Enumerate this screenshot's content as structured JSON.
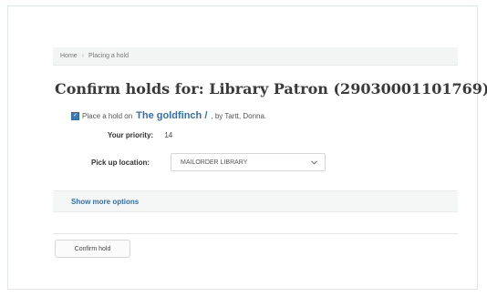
{
  "breadcrumb": {
    "items": [
      "Home",
      "Placing a hold"
    ],
    "separator": "›"
  },
  "page": {
    "title": "Confirm holds for: Library Patron (29030001101769)"
  },
  "hold": {
    "checkbox_checked": true,
    "prefix": "Place a hold on",
    "title": "The goldfinch /",
    "by": ", by Tartt, Donna."
  },
  "fields": {
    "priority_label": "Your priority:",
    "priority_value": "14",
    "pickup_label": "Pick up location:",
    "pickup_value": "MAILORDER LIBRARY"
  },
  "options": {
    "link_label": "Show more options"
  },
  "actions": {
    "confirm_label": "Confirm hold"
  },
  "colors": {
    "link": "#2f6fb4",
    "checkbox": "#3b7ab8"
  },
  "icons": {
    "chevron": "chevron-down-icon",
    "check": "check-icon"
  }
}
